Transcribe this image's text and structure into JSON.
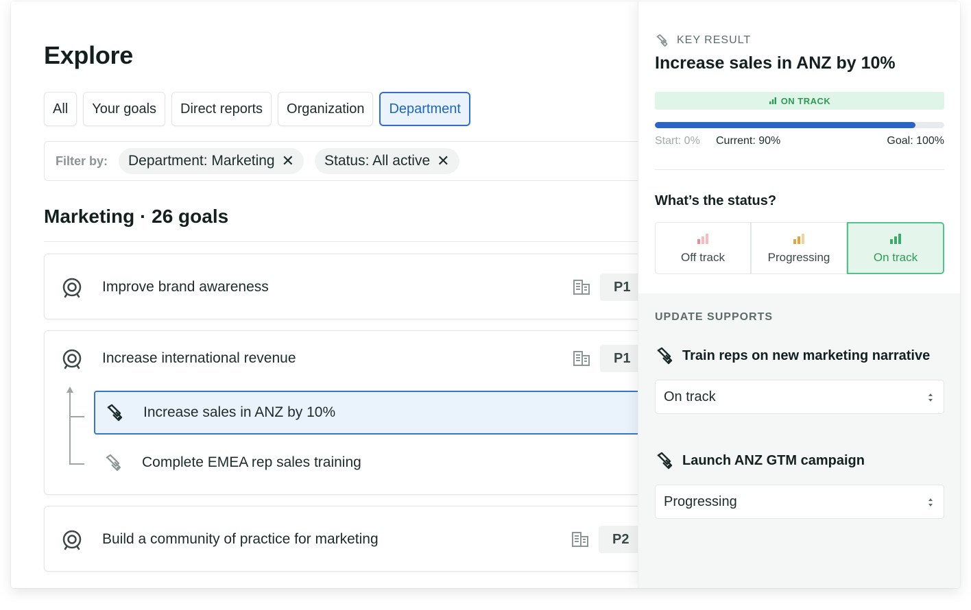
{
  "explore": {
    "title": "Explore",
    "tabs": [
      {
        "label": "All"
      },
      {
        "label": "Your goals"
      },
      {
        "label": "Direct reports"
      },
      {
        "label": "Organization"
      },
      {
        "label": "Department",
        "active": true
      }
    ],
    "filter": {
      "label": "Filter by:",
      "chips": [
        {
          "label": "Department: Marketing"
        },
        {
          "label": "Status: All active"
        }
      ]
    },
    "group_title": "Marketing · 26 goals",
    "goals": [
      {
        "title": "Improve brand awareness",
        "priority": "P1"
      },
      {
        "title": "Increase international revenue",
        "priority": "P1",
        "key_results": [
          {
            "title": "Increase sales in ANZ by 10%",
            "selected": true
          },
          {
            "title": "Complete EMEA rep sales training"
          }
        ]
      },
      {
        "title": "Build a community of practice for marketing",
        "priority": "P2"
      }
    ]
  },
  "panel": {
    "kicker": "KEY RESULT",
    "title": "Increase sales in ANZ by 10%",
    "status_band": "ON TRACK",
    "progress": {
      "fraction": 0.9,
      "start": "Start: 0%",
      "current": "Current: 90%",
      "goal": "Goal: 100%"
    },
    "question": "What’s the status?",
    "options": [
      {
        "label": "Off track",
        "color": "#f08a92"
      },
      {
        "label": "Progressing",
        "color": "#e6a23c"
      },
      {
        "label": "On track",
        "color": "#3daa67",
        "selected": true
      }
    ],
    "update_title": "UPDATE SUPPORTS",
    "supports": [
      {
        "name": "Train reps on new marketing narrative",
        "value": "On track"
      },
      {
        "name": "Launch ANZ GTM campaign",
        "value": "Progressing"
      }
    ]
  },
  "colors": {
    "accent": "#2f6fc7",
    "progress": "#2c63c7",
    "on_track": "#3daa67",
    "on_track_bg": "#dff5e7"
  }
}
